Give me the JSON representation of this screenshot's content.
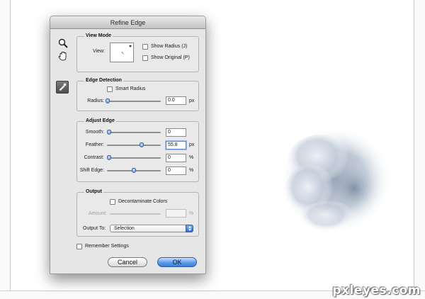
{
  "dialog": {
    "title": "Refine Edge"
  },
  "tools": {
    "zoom_icon": "magnifier-icon",
    "hand_icon": "hand-icon",
    "brush_icon": "refine-radius-brush-icon"
  },
  "view_mode": {
    "title": "View Mode",
    "view_label": "View:",
    "show_radius_label": "Show Radius (J)",
    "show_radius_checked": false,
    "show_original_label": "Show Original (P)",
    "show_original_checked": false
  },
  "edge_detection": {
    "title": "Edge Detection",
    "smart_radius_label": "Smart Radius",
    "smart_radius_checked": false,
    "radius_label": "Radius:",
    "radius_value": "0.0",
    "radius_unit": "px",
    "radius_fraction": 0.0
  },
  "adjust_edge": {
    "title": "Adjust Edge",
    "smooth_label": "Smooth:",
    "smooth_value": "0",
    "smooth_fraction": 0.0,
    "feather_label": "Feather:",
    "feather_value": "55.8",
    "feather_unit": "px",
    "feather_fraction": 0.65,
    "contrast_label": "Contrast:",
    "contrast_value": "0",
    "contrast_unit": "%",
    "contrast_fraction": 0.0,
    "shift_label": "Shift Edge:",
    "shift_value": "0",
    "shift_unit": "%",
    "shift_fraction": 0.5
  },
  "output": {
    "title": "Output",
    "decontaminate_label": "Decontaminate Colors",
    "decontaminate_checked": false,
    "amount_label": "Amount:",
    "amount_value": "",
    "amount_unit": "%",
    "output_to_label": "Output To:",
    "output_to_value": "Selection"
  },
  "remember": {
    "label": "Remember Settings",
    "checked": false
  },
  "buttons": {
    "cancel": "Cancel",
    "ok": "OK"
  },
  "watermark": "pxleyes.com"
}
